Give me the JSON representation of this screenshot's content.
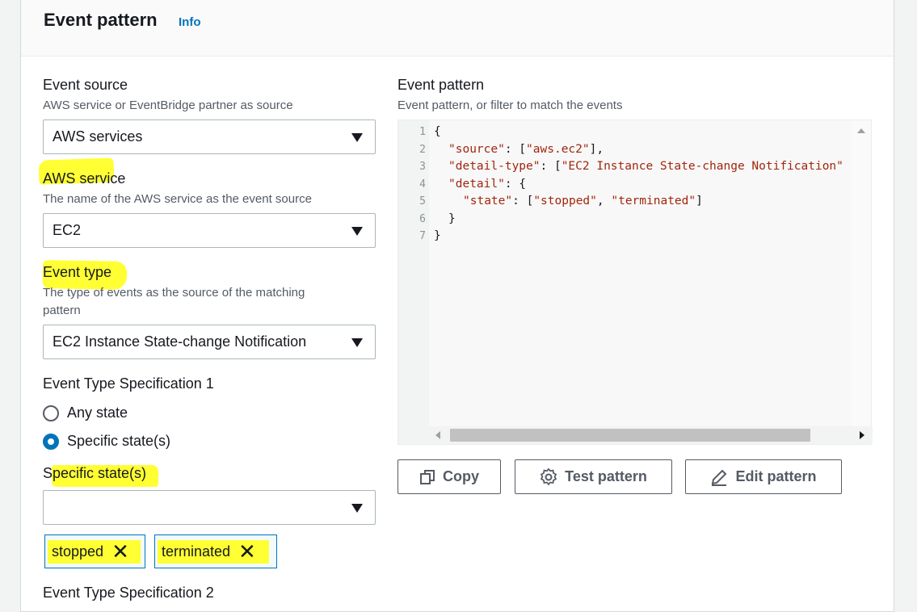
{
  "panel": {
    "title": "Event pattern",
    "info": "Info"
  },
  "left": {
    "event_source": {
      "label": "Event source",
      "desc": "AWS service or EventBridge partner as source",
      "value": "AWS services"
    },
    "aws_service": {
      "label": "AWS service",
      "desc": "The name of the AWS service as the event source",
      "value": "EC2"
    },
    "event_type": {
      "label": "Event type",
      "desc1": "The type of events as the source of the matching",
      "desc2": "pattern",
      "value": "EC2 Instance State-change Notification"
    },
    "spec1": {
      "label": "Event Type Specification 1",
      "options": [
        "Any state",
        "Specific state(s)"
      ],
      "selected": "Specific state(s)"
    },
    "specific_states": {
      "label": "Specific state(s)",
      "value": "",
      "tokens": [
        "stopped",
        "terminated"
      ]
    },
    "spec2": {
      "label": "Event Type Specification 2"
    }
  },
  "right": {
    "label": "Event pattern",
    "desc": "Event pattern, or filter to match the events",
    "code": {
      "line_numbers": [
        "1",
        "2",
        "3",
        "4",
        "5",
        "6",
        "7"
      ]
    },
    "buttons": {
      "copy": "Copy",
      "test": "Test pattern",
      "edit": "Edit pattern"
    }
  },
  "colors": {
    "highlight": "#ffff33",
    "accent": "#0073bb"
  },
  "icons": [
    "copy-icon",
    "gear-icon",
    "pencil-icon",
    "close-icon",
    "chevron-down-icon"
  ]
}
